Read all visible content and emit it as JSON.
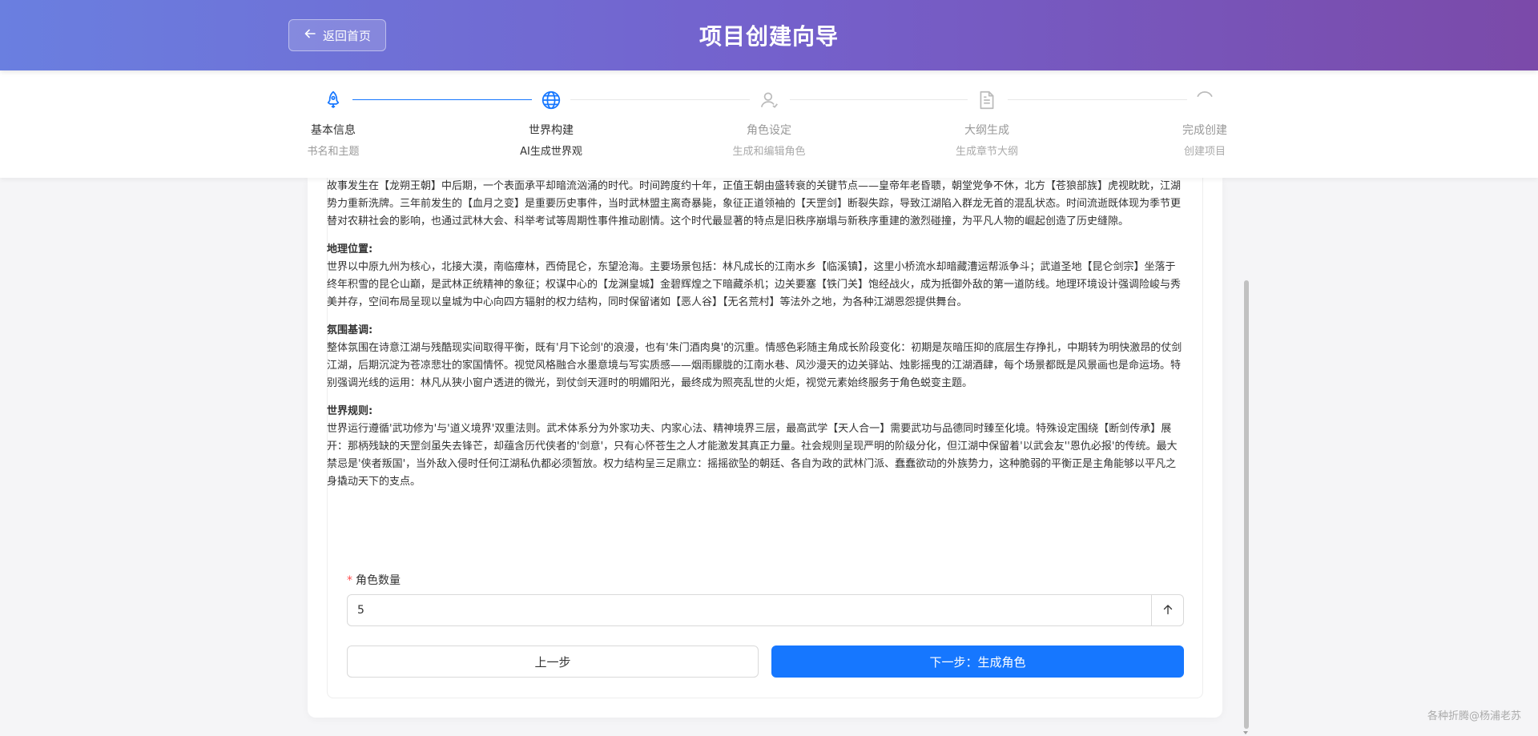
{
  "header": {
    "back_label": "返回首页",
    "title": "项目创建向导"
  },
  "steps": [
    {
      "title": "基本信息",
      "desc": "书名和主题",
      "status": "done",
      "icon": "rocket-icon"
    },
    {
      "title": "世界构建",
      "desc": "AI生成世界观",
      "status": "active",
      "icon": "globe-icon"
    },
    {
      "title": "角色设定",
      "desc": "生成和编辑角色",
      "status": "wait",
      "icon": "user-icon"
    },
    {
      "title": "大纲生成",
      "desc": "生成章节大纲",
      "status": "wait",
      "icon": "file-icon"
    },
    {
      "title": "完成创建",
      "desc": "创建项目",
      "status": "wait",
      "icon": "loading-icon"
    }
  ],
  "world": {
    "time_text": "故事发生在【龙朔王朝】中后期，一个表面承平却暗流汹涌的时代。时间跨度约十年，正值王朝由盛转衰的关键节点——皇帝年老昏聩，朝堂党争不休，北方【苍狼部族】虎视眈眈，江湖势力重新洗牌。三年前发生的【血月之变】是重要历史事件，当时武林盟主离奇暴毙，象征正道领袖的【天罡剑】断裂失踪，导致江湖陷入群龙无首的混乱状态。时间流逝既体现为季节更替对农耕社会的影响，也通过武林大会、科举考试等周期性事件推动剧情。这个时代最显著的特点是旧秩序崩塌与新秩序重建的激烈碰撞，为平凡人物的崛起创造了历史缝隙。",
    "geo_title": "地理位置:",
    "geo_text": "世界以中原九州为核心，北接大漠，南临瘴林，西倚昆仑，东望沧海。主要场景包括：林凡成长的江南水乡【临溪镇】，这里小桥流水却暗藏漕运帮派争斗；武道圣地【昆仑剑宗】坐落于终年积雪的昆仑山巅，是武林正统精神的象征；权谋中心的【龙渊皇城】金碧辉煌之下暗藏杀机；边关要塞【铁门关】饱经战火，成为抵御外敌的第一道防线。地理环境设计强调险峻与秀美并存，空间布局呈现以皇城为中心向四方辐射的权力结构，同时保留诸如【恶人谷】【无名荒村】等法外之地，为各种江湖恩怨提供舞台。",
    "mood_title": "氛围基调:",
    "mood_text": "整体氛围在诗意江湖与残酷现实间取得平衡，既有'月下论剑'的浪漫，也有'朱门酒肉臭'的沉重。情感色彩随主角成长阶段变化：初期是灰暗压抑的底层生存挣扎，中期转为明快激昂的仗剑江湖，后期沉淀为苍凉悲壮的家国情怀。视觉风格融合水墨意境与写实质感——烟雨朦胧的江南水巷、风沙漫天的边关驿站、烛影摇曳的江湖酒肆，每个场景都既是风景画也是命运场。特别强调光线的运用：林凡从狭小窗户透进的微光，到仗剑天涯时的明媚阳光，最终成为照亮乱世的火炬，视觉元素始终服务于角色蜕变主题。",
    "rules_title": "世界规则:",
    "rules_text": "世界运行遵循'武功修为'与'道义境界'双重法则。武术体系分为外家功夫、内家心法、精神境界三层，最高武学【天人合一】需要武功与品德同时臻至化境。特殊设定围绕【断剑传承】展开：那柄残缺的天罡剑虽失去锋芒，却蕴含历代侠者的'剑意'，只有心怀苍生之人才能激发其真正力量。社会规则呈现严明的阶级分化，但江湖中保留着'以武会友''恩仇必报'的传统。最大禁忌是'侠者叛国'，当外敌入侵时任何江湖私仇都必须暂放。权力结构呈三足鼎立：摇摇欲坠的朝廷、各自为政的武林门派、蠢蠢欲动的外族势力，这种脆弱的平衡正是主角能够以平凡之身撬动天下的支点。"
  },
  "form": {
    "count_label": "角色数量",
    "required_mark": "*",
    "count_value": "5"
  },
  "buttons": {
    "prev": "上一步",
    "next": "下一步：生成角色"
  },
  "watermark": "各种折腾@杨浦老苏",
  "colors": {
    "primary": "#1677ff",
    "header_start": "#6a7fe0",
    "header_end": "#7b4aa9"
  }
}
